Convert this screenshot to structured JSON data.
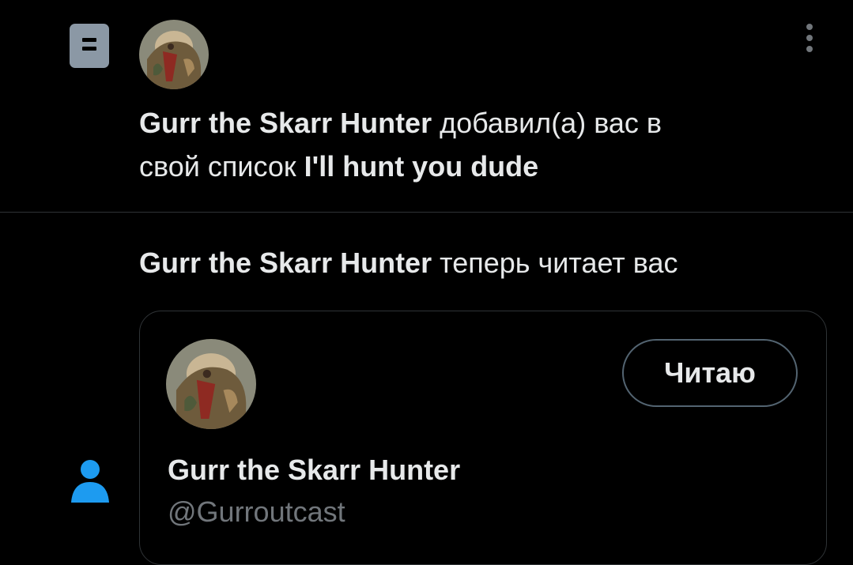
{
  "notifications": [
    {
      "type_icon": "list-icon",
      "avatar_icon": "profile-avatar",
      "user_name": "Gurr the Skarr Hunter",
      "line1_rest": "добавил(а) вас в",
      "line2_prefix": "свой список",
      "list_name": "I'll hunt you dude",
      "more_icon": "more-options-icon"
    },
    {
      "type_icon": "person-icon",
      "user_name": "Gurr the Skarr Hunter",
      "action": "теперь читает вас",
      "card": {
        "avatar_icon": "profile-avatar",
        "button_label": "Читаю",
        "name": "Gurr the Skarr Hunter",
        "handle": "@Gurroutcast"
      }
    }
  ],
  "colors": {
    "background": "#000000",
    "text": "#e7e9ea",
    "secondary_text": "#71767b",
    "divider": "#2f3336",
    "accent_blue": "#1d9bf0",
    "list_icon": "#8b98a5"
  }
}
